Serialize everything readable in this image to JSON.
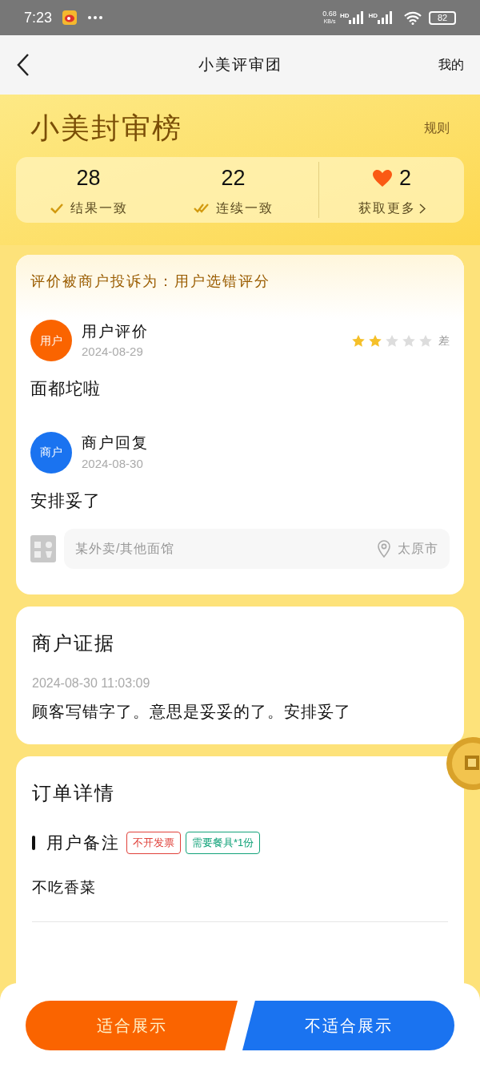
{
  "status_bar": {
    "time": "7:23",
    "speed": "0.68",
    "speed_unit": "KB/s",
    "networks": [
      "HD",
      "HD"
    ],
    "battery": "82"
  },
  "nav": {
    "title": "小美评审团",
    "right_action": "我的"
  },
  "header": {
    "title": "小美封审榜",
    "rules_link": "规则",
    "stats": [
      {
        "kind": "check",
        "value": "28",
        "label": "结果一致"
      },
      {
        "kind": "double_check",
        "value": "22",
        "label": "连续一致"
      },
      {
        "kind": "hearts",
        "value": "2",
        "label": "获取更多"
      }
    ]
  },
  "complaint": {
    "banner": "评价被商户投诉为：用户选错评分",
    "entries": [
      {
        "avatar_label": "用户",
        "color": "#fa6400",
        "title": "用户评价",
        "date": "2024-08-29",
        "stars": 2,
        "rating_label": "差",
        "text": "面都坨啦"
      },
      {
        "avatar_label": "商户",
        "color": "#1a73f0",
        "title": "商户回复",
        "date": "2024-08-30",
        "text": "安排妥了"
      }
    ],
    "shop": {
      "name": "某外卖/其他面馆",
      "location": "太原市"
    }
  },
  "evidence": {
    "title": "商户证据",
    "time": "2024-08-30 11:03:09",
    "text": "顾客写错字了。意思是妥妥的了。安排妥了"
  },
  "order": {
    "title": "订单详情",
    "sections": [
      {
        "title": "用户备注",
        "tags": [
          {
            "label": "不开发票",
            "color": "#e0413a"
          },
          {
            "label": "需要餐具*1份",
            "color": "#13a37a"
          }
        ],
        "text": "不吃香菜"
      }
    ]
  },
  "actions": [
    {
      "kind": "primary",
      "label": "适合展示"
    },
    {
      "kind": "secondary",
      "label": "不适合展示"
    }
  ]
}
